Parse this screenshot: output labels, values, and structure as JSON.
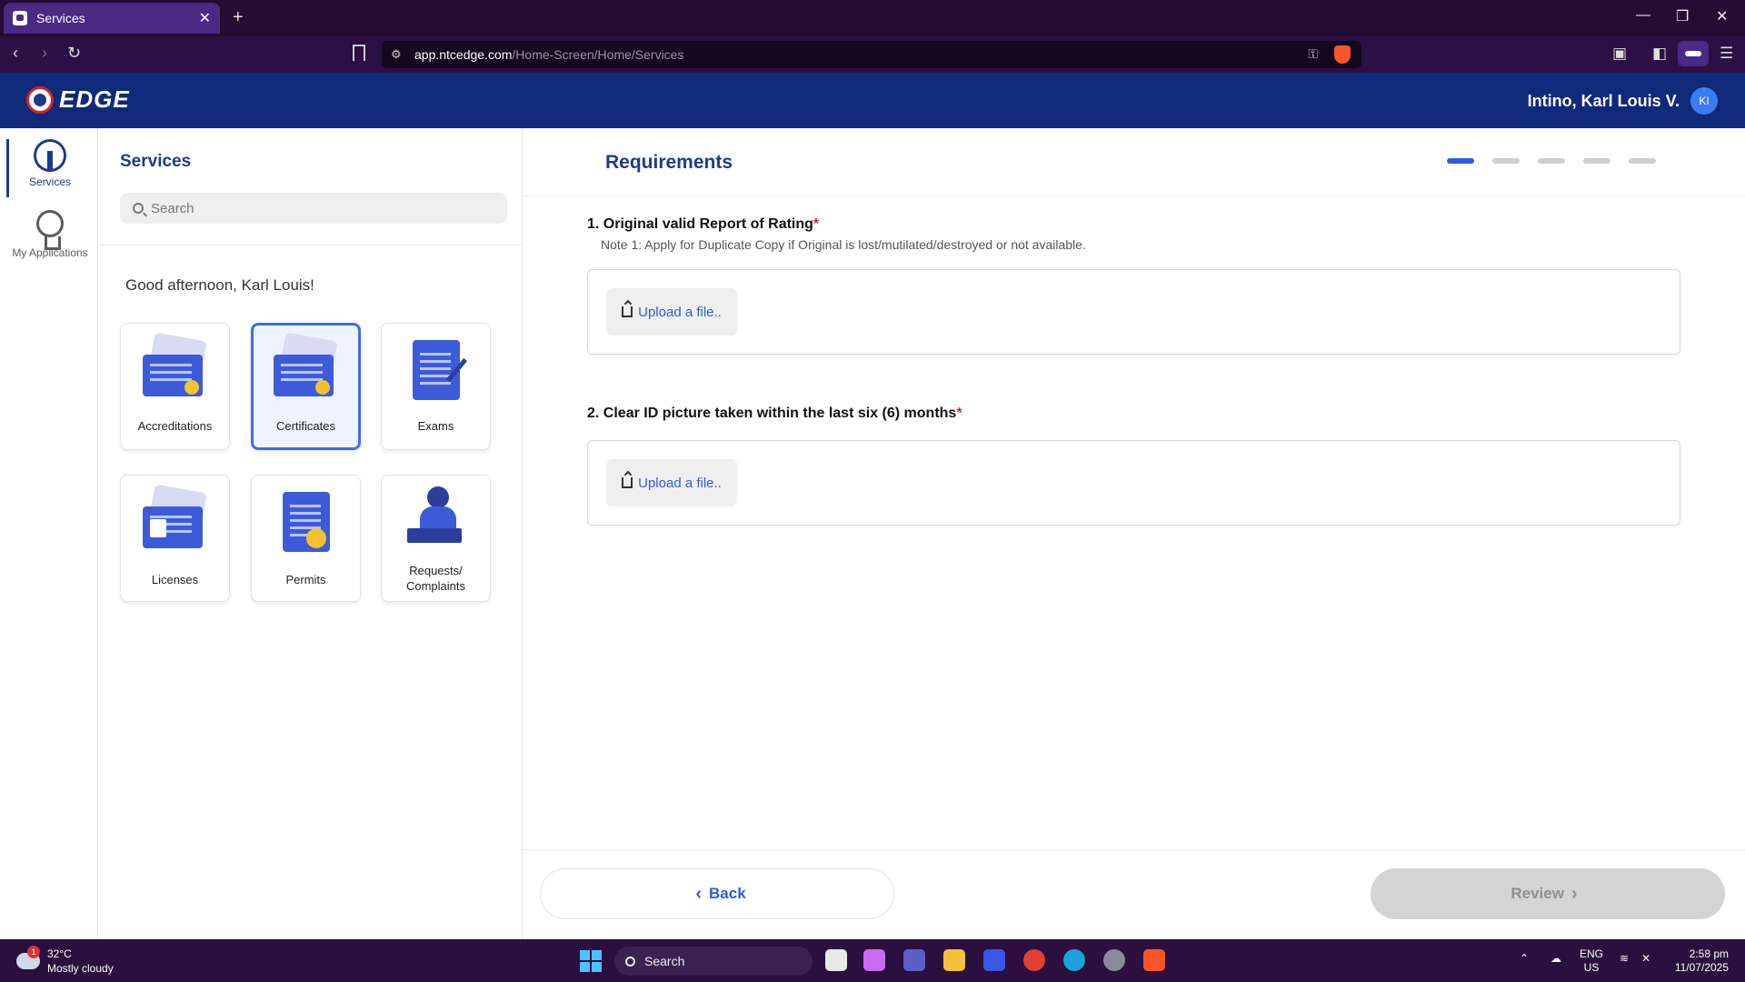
{
  "browser": {
    "tab_title": "Services",
    "url_host": "app.ntcedge.com",
    "url_path": "/Home-Screen/Home/Services"
  },
  "header": {
    "logo_text": "EDGE",
    "user_name": "Intino, Karl Louis V.",
    "user_initials": "KI"
  },
  "rail": {
    "items": [
      {
        "label": "Services",
        "icon": "antenna-icon",
        "active": true
      },
      {
        "label": "My Applications",
        "icon": "award-icon",
        "active": false
      }
    ]
  },
  "services": {
    "title": "Services",
    "search_placeholder": "Search",
    "greeting": "Good afternoon, Karl Louis!",
    "tiles": [
      {
        "label": "Accreditations",
        "selected": false
      },
      {
        "label": "Certificates",
        "selected": true
      },
      {
        "label": "Exams",
        "selected": false
      },
      {
        "label": "Licenses",
        "selected": false
      },
      {
        "label": "Permits",
        "selected": false
      },
      {
        "label": "Requests/ Complaints",
        "selected": false
      }
    ]
  },
  "main": {
    "title": "Requirements",
    "steps_total": 5,
    "current_step": 1,
    "requirements": [
      {
        "label": "1. Original valid Report of Rating",
        "required_mark": "*",
        "note": "Note 1: Apply for Duplicate Copy if Original is lost/mutilated/destroyed or not available.",
        "upload_label": "Upload a file.."
      },
      {
        "label": "2. Clear ID picture taken within the last six (6) months",
        "required_mark": "*",
        "upload_label": "Upload a file.."
      }
    ],
    "back_label": "Back",
    "review_label": "Review"
  },
  "taskbar": {
    "temperature": "32°C",
    "weather": "Mostly cloudy",
    "weather_badge": "1",
    "search_label": "Search",
    "lang": "ENG",
    "region": "US",
    "time": "2:58 pm",
    "date": "11/07/2025"
  },
  "colors": {
    "brand_blue": "#0f2a7a",
    "accent": "#2f5be0",
    "browser_bg": "#240c33"
  }
}
